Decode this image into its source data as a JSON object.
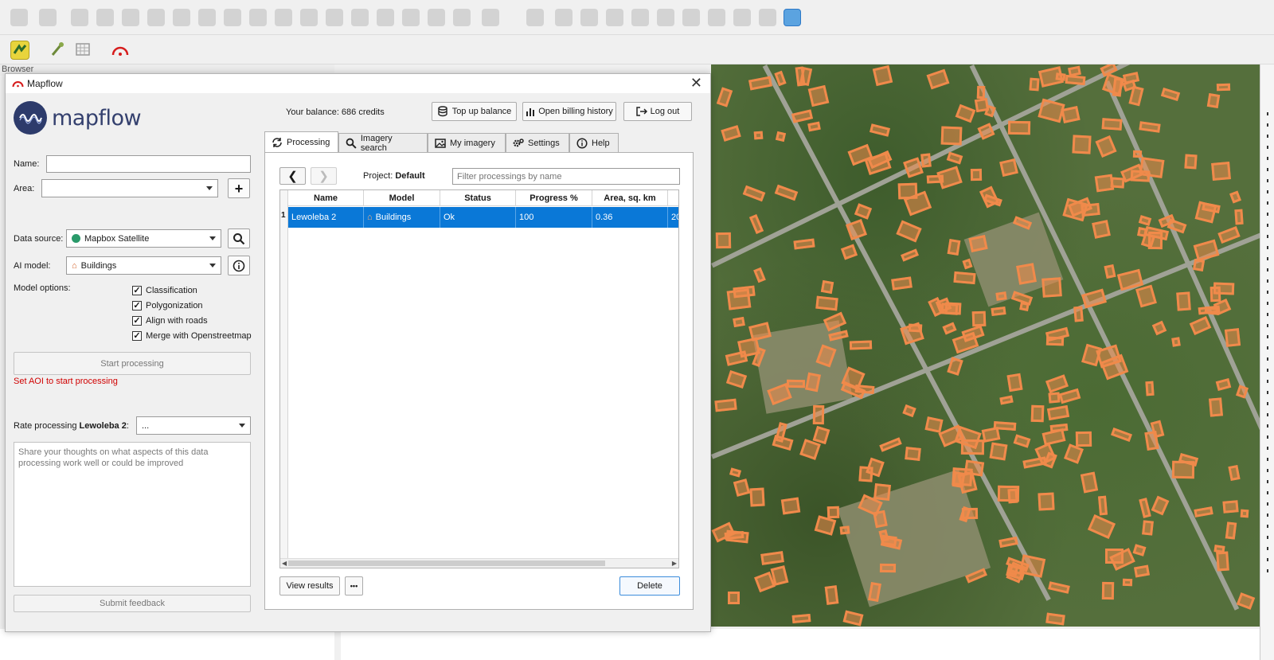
{
  "qgis": {
    "browser_label": "Browser"
  },
  "dialog": {
    "title": "Mapflow",
    "logo_text": "mapflow",
    "balance": "Your balance: 686 credits",
    "top_up_label": "Top up balance",
    "billing_label": "Open billing history",
    "logout_label": "Log out",
    "name_label": "Name:",
    "name_value": "",
    "area_label": "Area:",
    "area_value": "",
    "data_source_label": "Data source:",
    "data_source_value": "Mapbox Satellite",
    "ai_model_label": "AI model:",
    "ai_model_value": "Buildings",
    "model_options_label": "Model options:",
    "options": [
      {
        "label": "Classification",
        "checked": true
      },
      {
        "label": "Polygonization",
        "checked": true
      },
      {
        "label": "Align with roads",
        "checked": true
      },
      {
        "label": "Merge with Openstreetmap",
        "checked": true
      }
    ],
    "start_label": "Start processing",
    "error_text": "Set AOI to start processing",
    "rate_label_prefix": "Rate processing ",
    "rate_label_name": "Lewoleba 2",
    "rate_label_suffix": ":",
    "rate_value": "...",
    "feedback_placeholder": "Share your thoughts on what aspects of this data processing work well or could be improved",
    "submit_label": "Submit feedback",
    "tabs": [
      {
        "label": "Processing",
        "icon": "recycle-icon",
        "active": true
      },
      {
        "label": "Imagery search",
        "icon": "search-icon",
        "active": false
      },
      {
        "label": "My imagery",
        "icon": "image-icon",
        "active": false
      },
      {
        "label": "Settings",
        "icon": "settings-icon",
        "active": false
      },
      {
        "label": "Help",
        "icon": "info-icon",
        "active": false
      }
    ],
    "project_label": "Project:",
    "project_value": "Default",
    "filter_placeholder": "Filter processings by name",
    "table": {
      "columns": [
        "Name",
        "Model",
        "Status",
        "Progress %",
        "Area, sq. km",
        ""
      ],
      "rows": [
        {
          "index": "1",
          "name": "Lewoleba 2",
          "model": "Buildings",
          "status": "Ok",
          "progress": "100",
          "area": "0.36",
          "extra": "20"
        }
      ]
    },
    "view_results_label": "View results",
    "more_label": "•••",
    "delete_label": "Delete"
  },
  "colors": {
    "accent": "#0a78d7",
    "error": "#d00000",
    "building_outline": "#f08a4b",
    "logo": "#2d3b6b"
  }
}
